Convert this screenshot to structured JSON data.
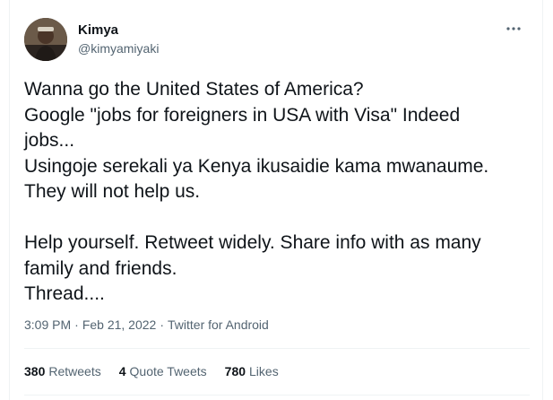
{
  "author": {
    "display_name": "Kimya",
    "handle": "@kimyamiyaki"
  },
  "tweet": {
    "text": "Wanna go the United States of America?\nGoogle \"jobs for foreigners in USA with Visa\" Indeed\njobs...\nUsingoje serekali ya Kenya ikusaidie kama mwanaume.\nThey will not help us.\n\nHelp yourself. Retweet widely. Share info with as many\nfamily and friends.\nThread....",
    "time": "3:09 PM",
    "separator": "·",
    "date": "Feb 21, 2022",
    "source": "Twitter for Android"
  },
  "stats": {
    "retweets_count": "380",
    "retweets_label": "Retweets",
    "quotes_count": "4",
    "quotes_label": "Quote Tweets",
    "likes_count": "780",
    "likes_label": "Likes"
  },
  "icons": {
    "more": "more-horizontal-icon"
  },
  "colors": {
    "text_primary": "#0f1419",
    "text_secondary": "#536471",
    "divider": "#eff3f4"
  }
}
